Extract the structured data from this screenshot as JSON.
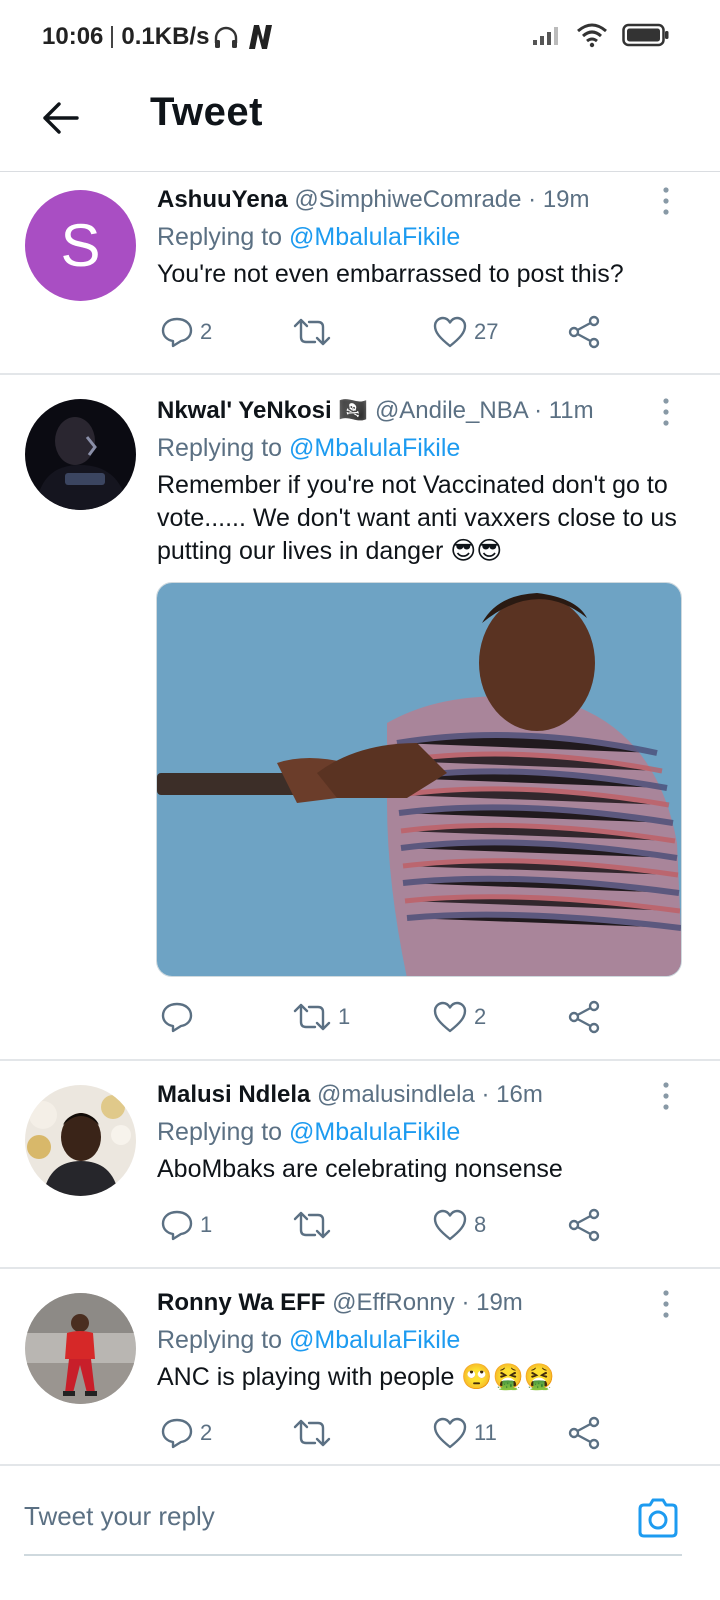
{
  "status_bar": {
    "time": "10:06",
    "network_speed": "0.1KB/s",
    "icons": [
      "headphones-icon",
      "netflix-n-icon",
      "signal-icon",
      "wifi-icon",
      "battery-icon"
    ]
  },
  "header": {
    "back_icon": "arrow-left-icon",
    "title": "Tweet"
  },
  "tweets": [
    {
      "name": "AshuuYena",
      "handle": "@SimphiweComrade",
      "time": "19m",
      "replying_label": "Replying to",
      "replying_to": "@MbalulaFikile",
      "text": "You're not even embarrassed to post this?",
      "avatar_letter": "S",
      "avatar_color": "#a94ec3",
      "replies": "2",
      "retweets": "",
      "likes": "27"
    },
    {
      "name": "Nkwal' YeNkosi",
      "name_emoji": "🏴‍☠️",
      "handle": "@Andile_NBA",
      "time": "11m",
      "replying_label": "Replying to",
      "replying_to": "@MbalulaFikile",
      "text": "Remember if you're not Vaccinated don't go to vote...... We don't want anti vaxxers close to us putting our lives in danger 😎😎",
      "replies": "",
      "retweets": "1",
      "likes": "2"
    },
    {
      "name": "Malusi Ndlela",
      "handle": "@malusindlela",
      "time": "16m",
      "replying_label": "Replying to",
      "replying_to": "@MbalulaFikile",
      "text": "AboMbaks are celebrating nonsense",
      "replies": "1",
      "retweets": "",
      "likes": "8"
    },
    {
      "name": "Ronny Wa EFF",
      "handle": "@EffRonny",
      "time": "19m",
      "replying_label": "Replying to",
      "replying_to": "@MbalulaFikile",
      "text": "ANC is playing with people 🙄🤮🤮",
      "replies": "2",
      "retweets": "",
      "likes": "11"
    }
  ],
  "reply_box": {
    "placeholder": "Tweet your reply",
    "camera_icon": "camera-icon"
  },
  "colors": {
    "link": "#1d9bf0",
    "secondary_text": "#5b7083",
    "primary_text": "#0f1419",
    "divider": "#e3e6e9"
  }
}
